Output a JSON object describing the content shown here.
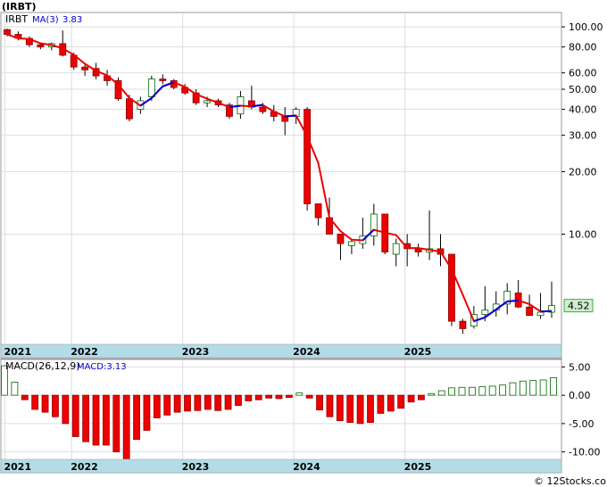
{
  "title": "(IRBT)",
  "price_panel": {
    "ticker_label": "IRBT",
    "ma_label": "MA(3)",
    "ma_value": "3.83",
    "last_price": "4.52",
    "y_ticks": [
      {
        "v": 100,
        "label": "100.00"
      },
      {
        "v": 80,
        "label": "80.00"
      },
      {
        "v": 60,
        "label": "60.00"
      },
      {
        "v": 50,
        "label": "50.00"
      },
      {
        "v": 40,
        "label": "40.00"
      },
      {
        "v": 30,
        "label": "30.00"
      },
      {
        "v": 20,
        "label": "20.00"
      },
      {
        "v": 10,
        "label": "10.00"
      }
    ]
  },
  "macd_panel": {
    "label": "MACD(26,12,9)",
    "value_label": "MACD:3.13",
    "y_ticks": [
      {
        "v": 5,
        "label": "5.00"
      },
      {
        "v": 0,
        "label": "0.00"
      },
      {
        "v": -5,
        "label": "-5.00"
      },
      {
        "v": -10,
        "label": "-10.00"
      }
    ]
  },
  "x_axis": {
    "labels": [
      {
        "label": "2021",
        "index": -0.2
      },
      {
        "label": "2022",
        "index": 5.8
      },
      {
        "label": "2023",
        "index": 15.8
      },
      {
        "label": "2024",
        "index": 25.8
      },
      {
        "label": "2025",
        "index": 35.8
      }
    ]
  },
  "watermark": "© 12Stocks.com",
  "colors": {
    "up": "#ffffff",
    "down": "#ee0000",
    "ma_red": "#ee0000",
    "ma_blue": "#0000dd",
    "axis_band": "#b4dce8",
    "macd_up": "#ffffff",
    "macd_up_stroke": "#006600",
    "macd_down": "#ee0000"
  },
  "chart_data": [
    {
      "type": "candlestick",
      "scale": "log",
      "ylim": [
        3.0,
        115
      ],
      "series": [
        {
          "name": "price",
          "ohlc": [
            [
              97,
              98,
              90,
              92
            ],
            [
              92,
              95,
              86,
              88
            ],
            [
              88,
              90,
              80,
              82
            ],
            [
              82,
              84,
              78,
              80
            ],
            [
              80,
              84,
              77,
              83
            ],
            [
              83,
              96,
              72,
              73
            ],
            [
              73,
              75,
              62,
              64
            ],
            [
              64,
              66,
              58,
              62
            ],
            [
              63,
              67,
              56,
              58
            ],
            [
              58,
              62,
              52,
              55
            ],
            [
              55,
              57,
              44,
              45
            ],
            [
              45,
              47,
              35,
              36
            ],
            [
              40,
              46,
              38,
              44
            ],
            [
              46,
              58,
              44,
              56
            ],
            [
              56,
              59,
              53,
              55
            ],
            [
              55,
              56,
              50,
              51
            ],
            [
              51,
              53,
              47,
              48
            ],
            [
              48,
              50,
              42,
              43
            ],
            [
              43,
              46,
              41,
              44
            ],
            [
              44,
              45,
              41,
              42
            ],
            [
              42,
              43,
              36,
              37
            ],
            [
              38,
              49,
              36,
              46
            ],
            [
              44,
              52,
              40,
              41
            ],
            [
              41,
              43,
              38,
              39
            ],
            [
              39,
              42,
              35,
              37
            ],
            [
              37,
              41,
              30,
              35
            ],
            [
              37,
              41,
              34,
              40
            ],
            [
              40,
              41,
              13,
              14
            ],
            [
              14,
              14,
              11,
              12
            ],
            [
              12,
              15,
              10,
              10
            ],
            [
              10,
              10,
              7.5,
              9
            ],
            [
              8.8,
              9.5,
              8,
              9.2
            ],
            [
              9,
              12,
              8.5,
              9.8
            ],
            [
              9.8,
              14,
              8.8,
              12.5
            ],
            [
              12.5,
              12.5,
              8,
              8.2
            ],
            [
              8,
              9.5,
              7,
              9
            ],
            [
              9,
              10,
              7,
              8.5
            ],
            [
              8.5,
              9,
              7.8,
              8.2
            ],
            [
              8.2,
              13,
              7.5,
              8.5
            ],
            [
              8.5,
              10,
              7,
              8
            ],
            [
              8,
              8,
              3.6,
              3.8
            ],
            [
              3.8,
              3.9,
              3.3,
              3.5
            ],
            [
              3.6,
              4.5,
              3.5,
              4.1
            ],
            [
              4.1,
              5.6,
              3.8,
              4.3
            ],
            [
              4.3,
              5.3,
              4.0,
              4.6
            ],
            [
              4.6,
              5.8,
              4.1,
              5.3
            ],
            [
              5.2,
              6.0,
              4.4,
              4.45
            ],
            [
              4.45,
              5.1,
              4.1,
              4.05
            ],
            [
              4.05,
              5.2,
              3.9,
              4.2
            ],
            [
              4.2,
              5.9,
              3.95,
              4.52
            ]
          ]
        },
        {
          "name": "MA(3)",
          "values": [
            95,
            92,
            88,
            85,
            83,
            80,
            77,
            71,
            65,
            60,
            56,
            52,
            47,
            44,
            46,
            49,
            52,
            54,
            55,
            56,
            53,
            50,
            49,
            46,
            44,
            43,
            42,
            39,
            null,
            null,
            null,
            null,
            null,
            null,
            null,
            null,
            null,
            null,
            null,
            null,
            null,
            null,
            null,
            null,
            null,
            null,
            null,
            null,
            null,
            null
          ]
        }
      ]
    },
    {
      "type": "bar",
      "ylim": [
        -11,
        6
      ],
      "series": [
        {
          "name": "MACD(26,12,9)",
          "values": [
            5.2,
            2.3,
            -0.8,
            -2.5,
            -3.0,
            -3.8,
            -5.0,
            -7.3,
            -8.2,
            -8.8,
            -8.8,
            -10.0,
            -11.2,
            -7.8,
            -6.2,
            -4.0,
            -3.5,
            -3.0,
            -2.8,
            -2.7,
            -2.5,
            -2.7,
            -2.5,
            -1.8,
            -1.0,
            -0.8,
            -0.5,
            -0.6,
            -0.4,
            0.4,
            -0.5,
            -2.6,
            -3.8,
            -4.5,
            -4.8,
            -5.0,
            -4.8,
            -3.2,
            -2.8,
            -2.3,
            -1.2,
            -0.8,
            0.3,
            0.8,
            1.3,
            1.4,
            1.4,
            1.5,
            1.6,
            1.8,
            2.2,
            2.5,
            2.6,
            2.7,
            3.1
          ]
        }
      ]
    }
  ]
}
